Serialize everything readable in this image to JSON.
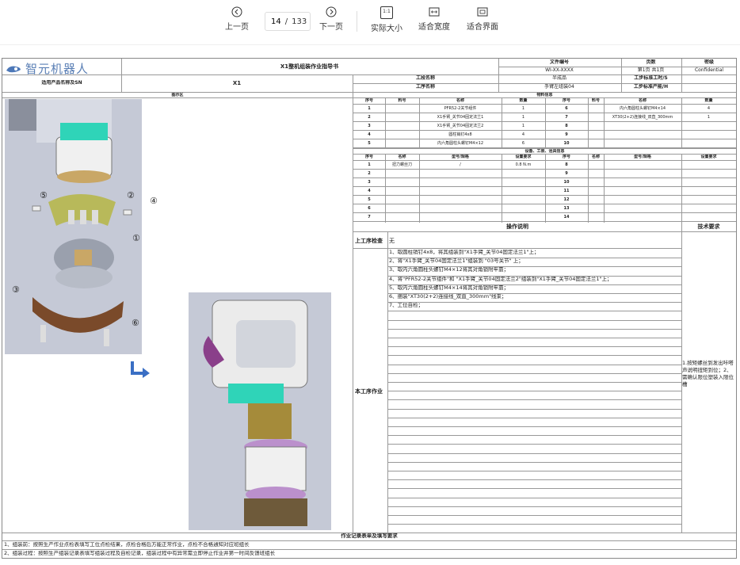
{
  "toolbar": {
    "prev_label": "上一页",
    "next_label": "下一页",
    "current_page": "14",
    "page_sep": "/",
    "total_pages": "133",
    "actual_size_label": "实际大小",
    "fit_width_label": "适合宽度",
    "fit_page_label": "适合界面",
    "actual_size_icon_text": "1:1"
  },
  "doc": {
    "logo_text": "智元机器人",
    "title": "X1整机组装作业指导书",
    "file_no_label": "文件编号",
    "file_no": "WI-XX-XXXX",
    "page_label": "页数",
    "page_value": "第1页 共1页",
    "secret_label": "密级",
    "secret_value": "Confidential",
    "product_label": "适用产品名称及SN",
    "product_value": "X1",
    "process_name_label": "工段名称",
    "process_name_value": "半成品",
    "std_time_label": "工步标准工时/S",
    "step_name_label": "工序名称",
    "step_name_value": "手臂左组装04",
    "std_capacity_label": "工步标准产能/H",
    "diagram_label": "图示区",
    "material_title": "物料信息",
    "material_headers": [
      "序号",
      "料号",
      "名称",
      "数量",
      "序号",
      "料号",
      "名称",
      "数量"
    ],
    "materials_left": [
      {
        "no": "1",
        "part": "",
        "name": "PFR52-2关节组件",
        "qty": "1"
      },
      {
        "no": "2",
        "part": "",
        "name": "X1手臂_关节04固定法兰1",
        "qty": "1"
      },
      {
        "no": "3",
        "part": "",
        "name": "X1手臂_关节04固定法兰2",
        "qty": "1"
      },
      {
        "no": "4",
        "part": "",
        "name": "圆柱销钉4x8",
        "qty": "4"
      },
      {
        "no": "5",
        "part": "",
        "name": "内六角圆柱头螺钉M4×12",
        "qty": "6"
      }
    ],
    "materials_right": [
      {
        "no": "6",
        "part": "",
        "name": "内六角圆柱头螺钉M4×14",
        "qty": "4"
      },
      {
        "no": "7",
        "part": "",
        "name": "XT30(2+2)连接线_双直_300mm",
        "qty": "1"
      },
      {
        "no": "8",
        "part": "",
        "name": "",
        "qty": ""
      },
      {
        "no": "9",
        "part": "",
        "name": "",
        "qty": ""
      },
      {
        "no": "10",
        "part": "",
        "name": "",
        "qty": ""
      }
    ],
    "tools_title": "设备、工装、治具信息",
    "tools_headers": [
      "序号",
      "名称",
      "型号/规格",
      "设置要求",
      "序号",
      "名称",
      "型号/规格",
      "设置要求"
    ],
    "tools_left": [
      {
        "no": "1",
        "name": "扭力螺丝刀",
        "model": "/",
        "setting": "0.8 N.m"
      },
      {
        "no": "2",
        "name": "",
        "model": "",
        "setting": ""
      },
      {
        "no": "3",
        "name": "",
        "model": "",
        "setting": ""
      },
      {
        "no": "4",
        "name": "",
        "model": "",
        "setting": ""
      },
      {
        "no": "5",
        "name": "",
        "model": "",
        "setting": ""
      },
      {
        "no": "6",
        "name": "",
        "model": "",
        "setting": ""
      },
      {
        "no": "7",
        "name": "",
        "model": "",
        "setting": ""
      }
    ],
    "tools_right_nos": [
      "8",
      "9",
      "10",
      "11",
      "12",
      "13",
      "14"
    ],
    "ops_title": "操作说明",
    "tech_title": "技术要求",
    "prev_check_label": "上工序检查",
    "prev_check_value": "无",
    "this_step_label": "本工序作业",
    "steps": [
      "1、取圆柱销钉4x8，将其组装到\"X1手臂_关节04固定法兰1\"上；",
      "2、将\"X1手臂_关节04固定法兰1\"组装到 \"03号关节\" 上；",
      "3、取内六角圆柱头螺钉M4×12将其对角锁附牢靠；",
      "4、将\"PFR52-2关节组件\"和 \"X1手臂_关节04固定法兰2\"组装到\"X1手臂_关节04固定法兰1\"上；",
      "5、取内六角圆柱头螺钉M4×14将其对角锁附牢靠；",
      "6、捆装\"XT30(2+2)连接线_双直_300mm\"线束；",
      "7、工位自检；"
    ],
    "tech_req": "1.按矩螺丝到发出咔嗒声说明扭矩到位；2、需确认限位塑装入限位槽",
    "record_title": "作业记录表单及填写要求",
    "record_1": "1、组装前：按照生产作业点检表填写工位点检结果，点检合格后方能正常作业，点检不合格通知对应班组长",
    "record_2": "2、组装过程：按照生产组装记录表填写组装过程及自检记录，组装过程中有异常需立即停止作业并第一时间反馈班组长",
    "callouts": [
      "①",
      "②",
      "③",
      "④",
      "⑤",
      "⑥"
    ]
  },
  "colors": {
    "accent": "#5a7fb5",
    "arrow": "#3a6fc4",
    "diagram_bg": "#c5c9d6"
  }
}
